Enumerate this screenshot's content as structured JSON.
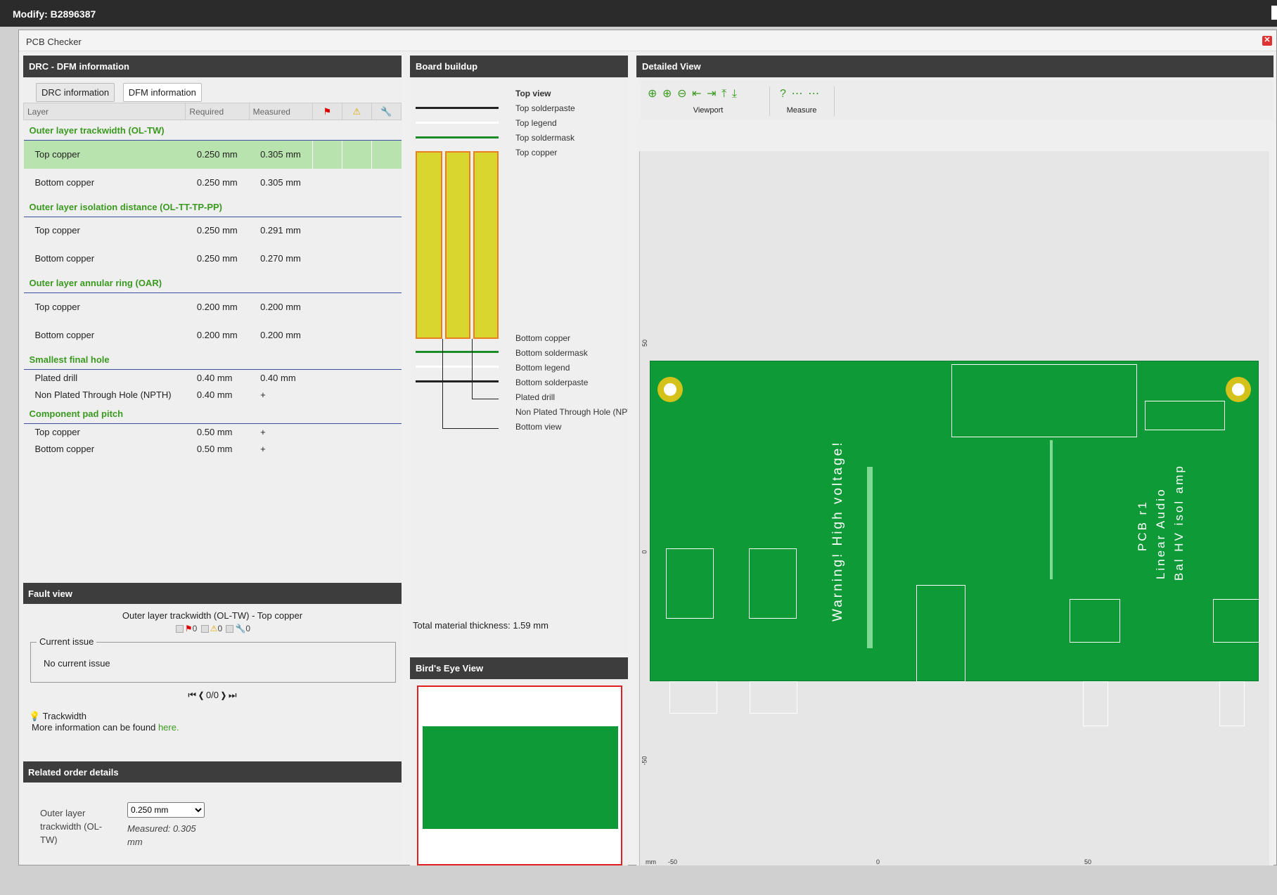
{
  "window": {
    "title": "Modify: B2896387",
    "dialog_title": "PCB Checker",
    "close": "✕"
  },
  "drc": {
    "header": "DRC - DFM information",
    "tabs": [
      "DRC information",
      "DFM information"
    ],
    "columns": {
      "layer": "Layer",
      "required": "Required",
      "measured": "Measured"
    },
    "groups": [
      {
        "title": "Outer layer trackwidth (OL-TW)",
        "rows": [
          {
            "layer": "Top copper",
            "required": "0.250 mm",
            "measured": "0.305 mm",
            "selected": true
          },
          {
            "layer": "Bottom copper",
            "required": "0.250 mm",
            "measured": "0.305 mm"
          }
        ]
      },
      {
        "title": "Outer layer isolation distance (OL-TT-TP-PP)",
        "rows": [
          {
            "layer": "Top copper",
            "required": "0.250 mm",
            "measured": "0.291 mm"
          },
          {
            "layer": "Bottom copper",
            "required": "0.250 mm",
            "measured": "0.270 mm"
          }
        ]
      },
      {
        "title": "Outer layer annular ring (OAR)",
        "rows": [
          {
            "layer": "Top copper",
            "required": "0.200 mm",
            "measured": "0.200 mm"
          },
          {
            "layer": "Bottom copper",
            "required": "0.200 mm",
            "measured": "0.200 mm"
          }
        ]
      },
      {
        "title": "Smallest final hole",
        "rows": [
          {
            "layer": "Plated drill",
            "required": "0.40 mm",
            "measured": "0.40 mm"
          },
          {
            "layer": "Non Plated Through Hole (NPTH)",
            "required": "0.40 mm",
            "measured": "+"
          }
        ]
      },
      {
        "title": "Component pad pitch",
        "rows": [
          {
            "layer": "Top copper",
            "required": "0.50 mm",
            "measured": "+"
          },
          {
            "layer": "Bottom copper",
            "required": "0.50 mm",
            "measured": "+"
          }
        ]
      }
    ]
  },
  "fault": {
    "header": "Fault view",
    "title": "Outer layer trackwidth (OL-TW) - Top copper",
    "counts": [
      "0",
      "0",
      "0"
    ],
    "current_issue_legend": "Current issue",
    "current_issue": "No current issue",
    "pager": "0/0",
    "tip_title": "Trackwidth",
    "tip_text": "More information can be found ",
    "tip_link": "here."
  },
  "related": {
    "header": "Related order details",
    "label": "Outer layer trackwidth (OL-TW)",
    "select_value": "0.250 mm",
    "measured": "Measured: 0.305 mm"
  },
  "buildup": {
    "header": "Board buildup",
    "layers_top": [
      "Top view",
      "Top solderpaste",
      "Top legend",
      "Top soldermask",
      "Top copper"
    ],
    "layers_bottom": [
      "Bottom copper",
      "Bottom soldermask",
      "Bottom legend",
      "Bottom solderpaste",
      "Plated drill",
      "Non Plated Through Hole (NPTH)",
      "Bottom view"
    ],
    "thickness": "Total material thickness: 1.59 mm"
  },
  "birdseye": {
    "header": "Bird's Eye View"
  },
  "detail": {
    "header": "Detailed View",
    "groups": [
      "Viewport",
      "Measure"
    ],
    "y_ticks": [
      "50",
      "0",
      "-50"
    ],
    "x_ticks": [
      "-50",
      "0",
      "50"
    ],
    "unit": "mm",
    "board_text": [
      "Warning! High voltage!",
      "PCB r1",
      "Linear Audio",
      "Bal HV isol amp"
    ],
    "colors": {
      "board": "#0d9a37",
      "pad": "#d4c21a",
      "accent": "#3a9a1f"
    }
  }
}
